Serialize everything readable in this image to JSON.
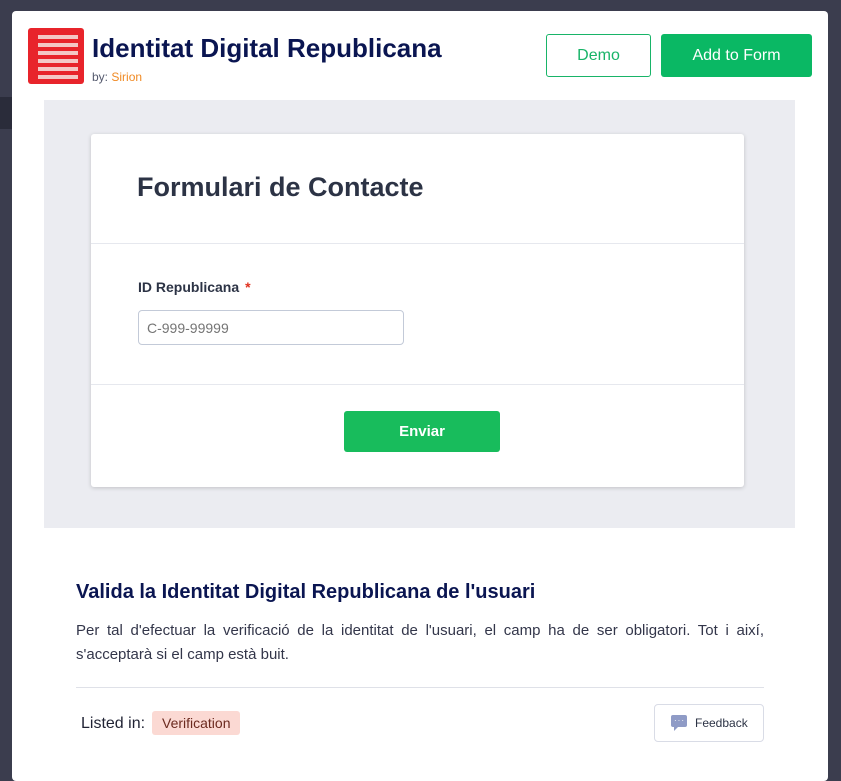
{
  "app": {
    "title": "Identitat Digital Republicana",
    "by_label": "by:",
    "author": "Sirion",
    "brand_color": "#e8242b",
    "logo_icon": "striped-flag-icon"
  },
  "header": {
    "demo_label": "Demo",
    "add_label": "Add to Form"
  },
  "form_preview": {
    "title": "Formulari de Contacte",
    "field_label": "ID Republicana",
    "required_mark": "*",
    "field_placeholder": "C-999-99999",
    "submit_label": "Enviar"
  },
  "description": {
    "title": "Valida la Identitat Digital Republicana de l'usuari",
    "text": "Per tal d'efectuar la verificació de la identitat de l'usuari, el camp ha de ser obligatori. Tot i així, s'acceptarà si el camp està buit."
  },
  "footer": {
    "listed_label": "Listed in:",
    "category": "Verification",
    "feedback_label": "Feedback",
    "feedback_icon": "chat-bubble-icon"
  },
  "colors": {
    "primary_green": "#0ab864",
    "title_navy": "#0a1551",
    "author_orange": "#f08a24"
  }
}
